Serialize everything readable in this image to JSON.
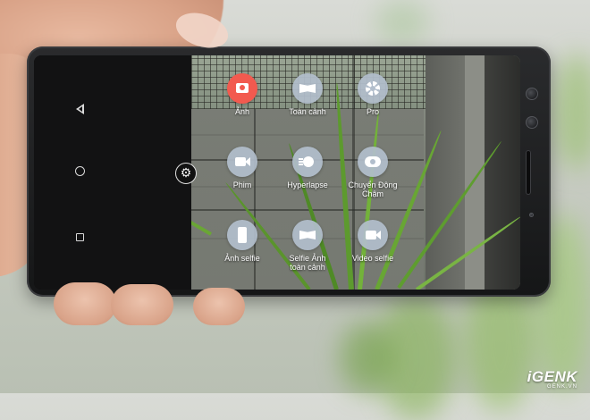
{
  "camera_app": {
    "settings_icon": "gear-icon",
    "modes": [
      {
        "label": "Ảnh",
        "icon": "camera-icon",
        "active": true
      },
      {
        "label": "Toàn cảnh",
        "icon": "panorama-icon",
        "active": false
      },
      {
        "label": "Pro",
        "icon": "aperture-icon",
        "active": false
      },
      {
        "label": "Phim",
        "icon": "video-camera-icon",
        "active": false
      },
      {
        "label": "Hyperlapse",
        "icon": "hyperlapse-icon",
        "active": false
      },
      {
        "label": "Chuyển Động Chậm",
        "icon": "slow-motion-icon",
        "active": false
      },
      {
        "label": "Ảnh selfie",
        "icon": "selfie-phone-icon",
        "active": false
      },
      {
        "label": "Selfie Ảnh toàn cảnh",
        "icon": "selfie-panorama-icon",
        "active": false
      },
      {
        "label": "Video selfie",
        "icon": "selfie-video-icon",
        "active": false
      }
    ],
    "accent_color": "#f25a4f",
    "icon_bg_color": "#b2becc"
  },
  "navigation_bar": {
    "back_icon": "back-triangle-icon",
    "home_icon": "home-circle-icon",
    "recents_icon": "recents-square-icon"
  },
  "watermark": {
    "main": "iGENK",
    "sub": "GENK.VN"
  }
}
